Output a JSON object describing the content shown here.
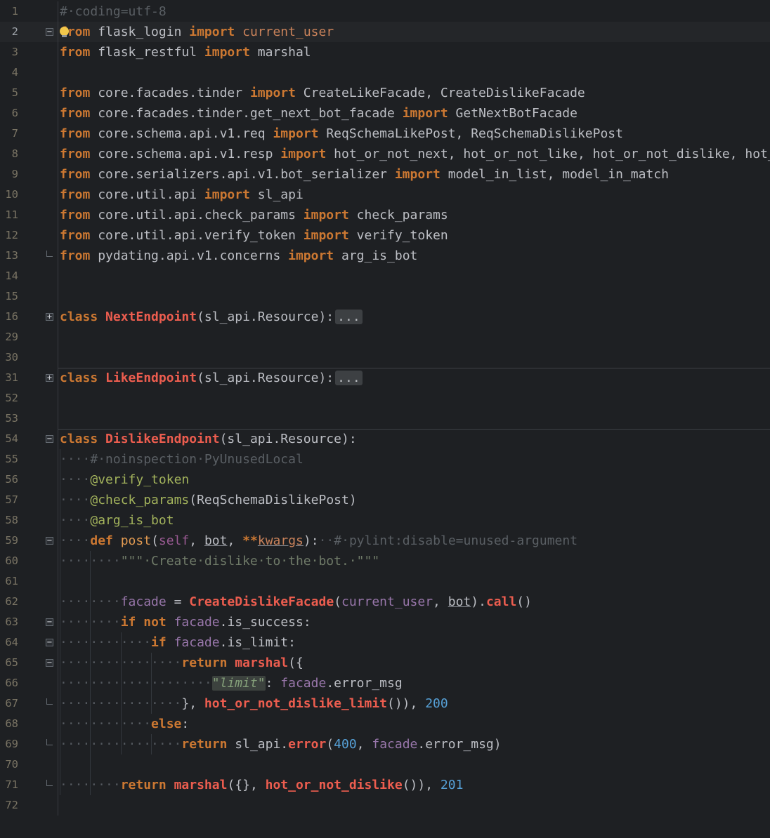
{
  "editor": {
    "palette": {
      "bg": "#1e2023",
      "curLine": "#242629",
      "gutterText": "#7a7464",
      "gutterTextActive": "#9ea3a9",
      "sep": "#393b40",
      "msep": "#3e4146",
      "guide": "#33373d",
      "kw": "#cc7832",
      "pl": "#bcbec4",
      "fn": "#ec5d4f",
      "dec": "#a3b35c",
      "self": "#9a5a93",
      "var": "#9876aa",
      "num": "#56a0d6",
      "str": "#85a07a",
      "doc": "#6f7a68",
      "com": "#5a5f64",
      "ws": "#54595f",
      "tan": "#c9825a",
      "fndef": "#e39b52",
      "chipBg": "#3d4043",
      "chipText": "#b9bcc1",
      "hlBg": "#3c423e",
      "iconBorder": "#646a71",
      "iconBg": "#2b2e33",
      "iconGlyph": "#c2c5ca",
      "underline": "#8a8e95",
      "bulb": "#f2c74b",
      "bulbBase": "#8f9398"
    },
    "icons": {
      "bulb": "intention-bulb-icon",
      "minus": "fold-collapse-icon",
      "plus": "fold-expand-icon",
      "end": "fold-end-icon"
    },
    "fold_glyphs": {
      "minus": "−",
      "plus": "+",
      "end": ""
    },
    "lines": [
      {
        "n": "1",
        "tok": [
          {
            "t": "#·coding=utf-8",
            "c": "com"
          }
        ]
      },
      {
        "n": "2",
        "cur": true,
        "fold": "minus",
        "bulb": true,
        "tok": [
          {
            "t": "from",
            "c": "kw"
          },
          {
            "t": " flask_login ",
            "c": "pl"
          },
          {
            "t": "import",
            "c": "kw"
          },
          {
            "t": " ",
            "c": "pl"
          },
          {
            "t": "current_user",
            "c": "tan"
          }
        ]
      },
      {
        "n": "3",
        "tok": [
          {
            "t": "from",
            "c": "kw"
          },
          {
            "t": " flask_restful ",
            "c": "pl"
          },
          {
            "t": "import",
            "c": "kw"
          },
          {
            "t": " marshal",
            "c": "pl"
          }
        ]
      },
      {
        "n": "4",
        "tok": []
      },
      {
        "n": "5",
        "tok": [
          {
            "t": "from",
            "c": "kw"
          },
          {
            "t": " core.facades.tinder ",
            "c": "pl"
          },
          {
            "t": "import",
            "c": "kw"
          },
          {
            "t": " CreateLikeFacade, CreateDislikeFacade",
            "c": "pl"
          }
        ]
      },
      {
        "n": "6",
        "tok": [
          {
            "t": "from",
            "c": "kw"
          },
          {
            "t": " core.facades.tinder.get_next_bot_facade ",
            "c": "pl"
          },
          {
            "t": "import",
            "c": "kw"
          },
          {
            "t": " GetNextBotFacade",
            "c": "pl"
          }
        ]
      },
      {
        "n": "7",
        "tok": [
          {
            "t": "from",
            "c": "kw"
          },
          {
            "t": " core.schema.api.v1.req ",
            "c": "pl"
          },
          {
            "t": "import",
            "c": "kw"
          },
          {
            "t": " ReqSchemaLikePost, ReqSchemaDislikePost",
            "c": "pl"
          }
        ]
      },
      {
        "n": "8",
        "tok": [
          {
            "t": "from",
            "c": "kw"
          },
          {
            "t": " core.schema.api.v1.resp ",
            "c": "pl"
          },
          {
            "t": "import",
            "c": "kw"
          },
          {
            "t": " hot_or_not_next, hot_or_not_like, hot_or_not_dislike, hot_or_not_dislike_limit",
            "c": "pl"
          }
        ]
      },
      {
        "n": "9",
        "tok": [
          {
            "t": "from",
            "c": "kw"
          },
          {
            "t": " core.serializers.api.v1.bot_serializer ",
            "c": "pl"
          },
          {
            "t": "import",
            "c": "kw"
          },
          {
            "t": " model_in_list, model_in_match",
            "c": "pl"
          }
        ]
      },
      {
        "n": "10",
        "tok": [
          {
            "t": "from",
            "c": "kw"
          },
          {
            "t": " core.util.api ",
            "c": "pl"
          },
          {
            "t": "import",
            "c": "kw"
          },
          {
            "t": " sl_api",
            "c": "pl"
          }
        ]
      },
      {
        "n": "11",
        "tok": [
          {
            "t": "from",
            "c": "kw"
          },
          {
            "t": " core.util.api.check_params ",
            "c": "pl"
          },
          {
            "t": "import",
            "c": "kw"
          },
          {
            "t": " check_params",
            "c": "pl"
          }
        ]
      },
      {
        "n": "12",
        "tok": [
          {
            "t": "from",
            "c": "kw"
          },
          {
            "t": " core.util.api.verify_token ",
            "c": "pl"
          },
          {
            "t": "import",
            "c": "kw"
          },
          {
            "t": " verify_token",
            "c": "pl"
          }
        ]
      },
      {
        "n": "13",
        "fold": "end",
        "tok": [
          {
            "t": "from",
            "c": "kw"
          },
          {
            "t": " pydating.api.v1.concerns ",
            "c": "pl"
          },
          {
            "t": "import",
            "c": "kw"
          },
          {
            "t": " arg_is_bot",
            "c": "pl"
          }
        ]
      },
      {
        "n": "14",
        "tok": []
      },
      {
        "n": "15",
        "tok": []
      },
      {
        "n": "16",
        "fold": "plus",
        "tok": [
          {
            "t": "class",
            "c": "kw"
          },
          {
            "t": " ",
            "c": "pl"
          },
          {
            "t": "NextEndpoint",
            "c": "fn"
          },
          {
            "t": "(sl_api.Resource):",
            "c": "pl"
          },
          {
            "t": "...",
            "c": "fold"
          }
        ]
      },
      {
        "n": "29",
        "tok": []
      },
      {
        "n": "30",
        "tok": []
      },
      {
        "n": "31",
        "fold": "plus",
        "sep": true,
        "tok": [
          {
            "t": "class",
            "c": "kw"
          },
          {
            "t": " ",
            "c": "pl"
          },
          {
            "t": "LikeEndpoint",
            "c": "fn"
          },
          {
            "t": "(sl_api.Resource):",
            "c": "pl"
          },
          {
            "t": "...",
            "c": "fold"
          }
        ]
      },
      {
        "n": "52",
        "tok": []
      },
      {
        "n": "53",
        "tok": []
      },
      {
        "n": "54",
        "fold": "minus",
        "sep": true,
        "tok": [
          {
            "t": "class",
            "c": "kw"
          },
          {
            "t": " ",
            "c": "pl"
          },
          {
            "t": "DislikeEndpoint",
            "c": "fn"
          },
          {
            "t": "(sl_api.Resource):",
            "c": "pl"
          }
        ]
      },
      {
        "n": "55",
        "g": [
          0
        ],
        "tok": [
          {
            "t": "····",
            "c": "ws"
          },
          {
            "t": "#·noinspection·PyUnusedLocal",
            "c": "com"
          }
        ]
      },
      {
        "n": "56",
        "g": [
          0
        ],
        "tok": [
          {
            "t": "····",
            "c": "ws"
          },
          {
            "t": "@verify_token",
            "c": "dec"
          }
        ]
      },
      {
        "n": "57",
        "g": [
          0
        ],
        "tok": [
          {
            "t": "····",
            "c": "ws"
          },
          {
            "t": "@check_params",
            "c": "dec"
          },
          {
            "t": "(ReqSchemaDislikePost)",
            "c": "pl"
          }
        ]
      },
      {
        "n": "58",
        "g": [
          0
        ],
        "tok": [
          {
            "t": "····",
            "c": "ws"
          },
          {
            "t": "@arg_is_bot",
            "c": "dec"
          }
        ]
      },
      {
        "n": "59",
        "fold": "minus",
        "g": [
          0
        ],
        "tok": [
          {
            "t": "····",
            "c": "ws"
          },
          {
            "t": "def",
            "c": "kw"
          },
          {
            "t": " ",
            "c": "pl"
          },
          {
            "t": "post",
            "c": "fndef"
          },
          {
            "t": "(",
            "c": "pl"
          },
          {
            "t": "self",
            "c": "self"
          },
          {
            "t": ", ",
            "c": "pl"
          },
          {
            "t": "bot",
            "c": "pl u"
          },
          {
            "t": ", ",
            "c": "pl"
          },
          {
            "t": "**",
            "c": "kw"
          },
          {
            "t": "kwargs",
            "c": "tan u"
          },
          {
            "t": "):",
            "c": "pl"
          },
          {
            "t": "··",
            "c": "ws"
          },
          {
            "t": "#·pylint:disable=unused-argument",
            "c": "com"
          }
        ]
      },
      {
        "n": "60",
        "g": [
          0,
          4
        ],
        "tok": [
          {
            "t": "········",
            "c": "ws"
          },
          {
            "t": "\"\"\"·Create·dislike·to·the·bot.·\"\"\"",
            "c": "doc"
          }
        ]
      },
      {
        "n": "61",
        "g": [
          0,
          4
        ],
        "tok": []
      },
      {
        "n": "62",
        "g": [
          0,
          4
        ],
        "tok": [
          {
            "t": "········",
            "c": "ws"
          },
          {
            "t": "facade",
            "c": "var"
          },
          {
            "t": " = ",
            "c": "pl"
          },
          {
            "t": "CreateDislikeFacade",
            "c": "fn"
          },
          {
            "t": "(",
            "c": "pl"
          },
          {
            "t": "current_user",
            "c": "var"
          },
          {
            "t": ", ",
            "c": "pl"
          },
          {
            "t": "bot",
            "c": "pl u"
          },
          {
            "t": ").",
            "c": "pl"
          },
          {
            "t": "call",
            "c": "fn"
          },
          {
            "t": "()",
            "c": "pl"
          }
        ]
      },
      {
        "n": "63",
        "fold": "minus",
        "g": [
          0,
          4
        ],
        "tok": [
          {
            "t": "········",
            "c": "ws"
          },
          {
            "t": "if",
            "c": "kw"
          },
          {
            "t": " ",
            "c": "pl"
          },
          {
            "t": "not",
            "c": "kw"
          },
          {
            "t": " ",
            "c": "pl"
          },
          {
            "t": "facade",
            "c": "var"
          },
          {
            "t": ".is_success:",
            "c": "pl"
          }
        ]
      },
      {
        "n": "64",
        "fold": "minus",
        "g": [
          0,
          4,
          8
        ],
        "tok": [
          {
            "t": "············",
            "c": "ws"
          },
          {
            "t": "if",
            "c": "kw"
          },
          {
            "t": " ",
            "c": "pl"
          },
          {
            "t": "facade",
            "c": "var"
          },
          {
            "t": ".is_limit:",
            "c": "pl"
          }
        ]
      },
      {
        "n": "65",
        "fold": "minus",
        "g": [
          0,
          4,
          8,
          12
        ],
        "tok": [
          {
            "t": "················",
            "c": "ws"
          },
          {
            "t": "return",
            "c": "kw"
          },
          {
            "t": " ",
            "c": "pl"
          },
          {
            "t": "marshal",
            "c": "fn"
          },
          {
            "t": "({",
            "c": "pl"
          }
        ]
      },
      {
        "n": "66",
        "g": [
          0,
          4,
          8,
          12
        ],
        "tok": [
          {
            "t": "····················",
            "c": "ws"
          },
          {
            "t": "\"limit\"",
            "c": "str hl"
          },
          {
            "t": ": ",
            "c": "pl"
          },
          {
            "t": "facade",
            "c": "var"
          },
          {
            "t": ".error_msg",
            "c": "pl"
          }
        ]
      },
      {
        "n": "67",
        "fold": "end",
        "g": [
          0,
          4,
          8,
          12
        ],
        "tok": [
          {
            "t": "················",
            "c": "ws"
          },
          {
            "t": "}, ",
            "c": "pl"
          },
          {
            "t": "hot_or_not_dislike_limit",
            "c": "fn"
          },
          {
            "t": "()), ",
            "c": "pl"
          },
          {
            "t": "200",
            "c": "num"
          }
        ]
      },
      {
        "n": "68",
        "g": [
          0,
          4,
          8
        ],
        "tok": [
          {
            "t": "············",
            "c": "ws"
          },
          {
            "t": "else",
            "c": "kw"
          },
          {
            "t": ":",
            "c": "pl"
          }
        ]
      },
      {
        "n": "69",
        "fold": "end",
        "g": [
          0,
          4,
          8,
          12
        ],
        "tok": [
          {
            "t": "················",
            "c": "ws"
          },
          {
            "t": "return",
            "c": "kw"
          },
          {
            "t": " ",
            "c": "pl"
          },
          {
            "t": "sl_api.",
            "c": "pl"
          },
          {
            "t": "error",
            "c": "fn"
          },
          {
            "t": "(",
            "c": "pl"
          },
          {
            "t": "400",
            "c": "num"
          },
          {
            "t": ", ",
            "c": "pl"
          },
          {
            "t": "facade",
            "c": "var"
          },
          {
            "t": ".error_msg)",
            "c": "pl"
          }
        ]
      },
      {
        "n": "70",
        "g": [
          0,
          4
        ],
        "tok": []
      },
      {
        "n": "71",
        "fold": "end",
        "g": [
          0,
          4
        ],
        "tok": [
          {
            "t": "········",
            "c": "ws"
          },
          {
            "t": "return",
            "c": "kw"
          },
          {
            "t": " ",
            "c": "pl"
          },
          {
            "t": "marshal",
            "c": "fn"
          },
          {
            "t": "({}, ",
            "c": "pl"
          },
          {
            "t": "hot_or_not_dislike",
            "c": "fn"
          },
          {
            "t": "()), ",
            "c": "pl"
          },
          {
            "t": "201",
            "c": "num"
          }
        ]
      },
      {
        "n": "72",
        "tok": []
      }
    ]
  }
}
